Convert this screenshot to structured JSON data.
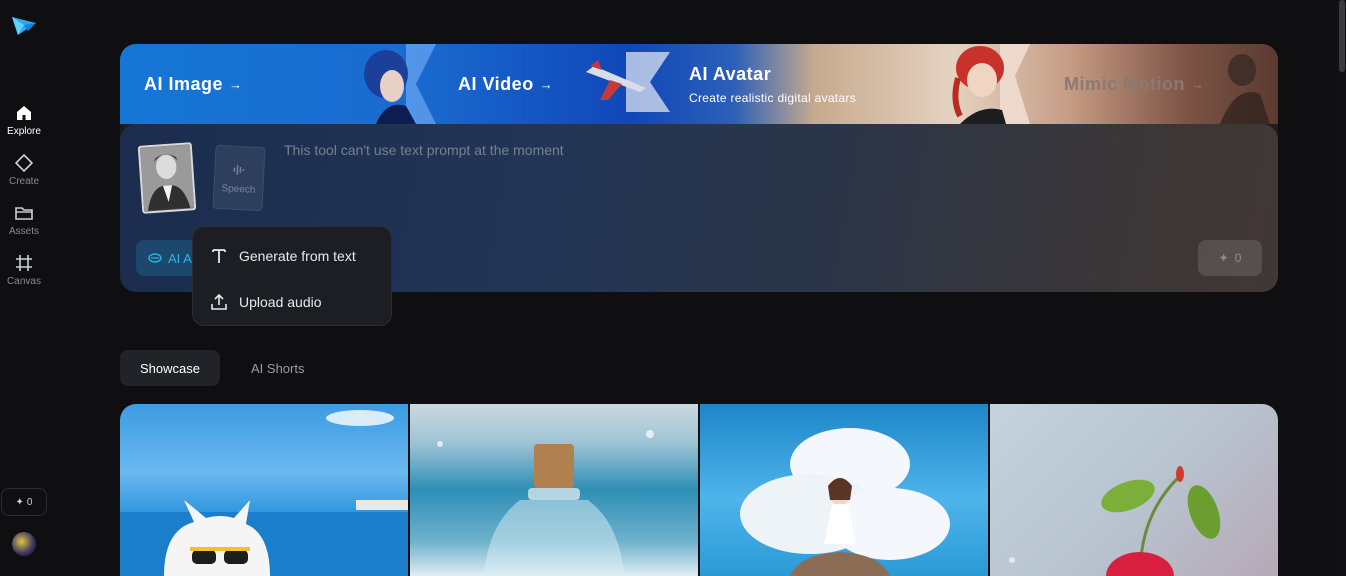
{
  "sidebar": {
    "items": [
      {
        "label": "Explore",
        "icon": "home-icon",
        "active": true
      },
      {
        "label": "Create",
        "icon": "diamond-icon",
        "active": false
      },
      {
        "label": "Assets",
        "icon": "folder-icon",
        "active": false
      },
      {
        "label": "Canvas",
        "icon": "frame-icon",
        "active": false
      }
    ],
    "credits": "0"
  },
  "banner": {
    "tabs": [
      {
        "title": "AI Image",
        "arrow": "→"
      },
      {
        "title": "AI Video",
        "arrow": "→"
      },
      {
        "title": "AI Avatar",
        "subtitle": "Create realistic digital avatars"
      },
      {
        "title": "Mimic Motion",
        "arrow": "→"
      }
    ]
  },
  "composer": {
    "speech_label": "Speech",
    "placeholder": "This tool can't use text prompt at the moment",
    "mode_chip": "AI A",
    "generate_cost": "0"
  },
  "dropdown": {
    "items": [
      {
        "label": "Generate from text",
        "icon": "text-icon"
      },
      {
        "label": "Upload audio",
        "icon": "upload-icon"
      }
    ]
  },
  "section_tabs": {
    "showcase": "Showcase",
    "shorts": "AI Shorts"
  },
  "colors": {
    "accent": "#29b5e8",
    "background": "#0f0f11"
  }
}
